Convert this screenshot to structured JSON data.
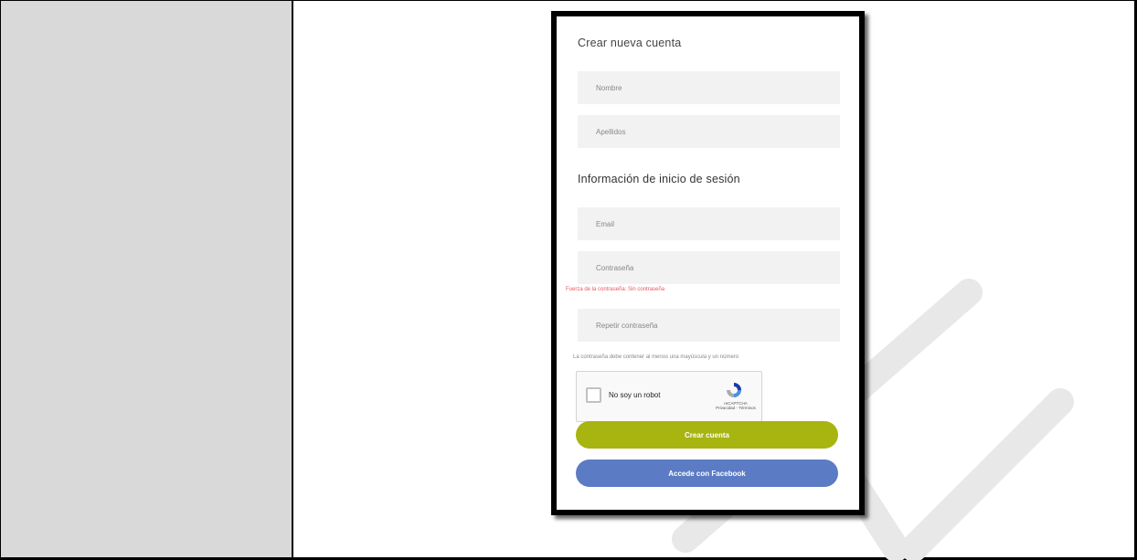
{
  "form": {
    "title": "Crear nueva cuenta",
    "name_placeholder": "Nombre",
    "lastname_placeholder": "Apellidos",
    "login_section_title": "Información de inicio de sesión",
    "email_placeholder": "Email",
    "password_placeholder": "Contraseña",
    "password_strength": "Fuerza de la contraseña: Sin contraseña",
    "repeat_password_placeholder": "Repetir contraseña",
    "password_hint": "La contraseña debe contener al menos una mayúscula y un número"
  },
  "captcha": {
    "label": "No soy un robot",
    "brand": "reCAPTCHA",
    "links": "Privacidad - Términos"
  },
  "buttons": {
    "create_account": "Crear cuenta",
    "facebook_login": "Accede con Facebook"
  },
  "colors": {
    "create_button": "#a8b410",
    "facebook_button": "#5b7bc4",
    "error_text": "#e8585c",
    "sidebar_bg": "#d9d9d9"
  }
}
